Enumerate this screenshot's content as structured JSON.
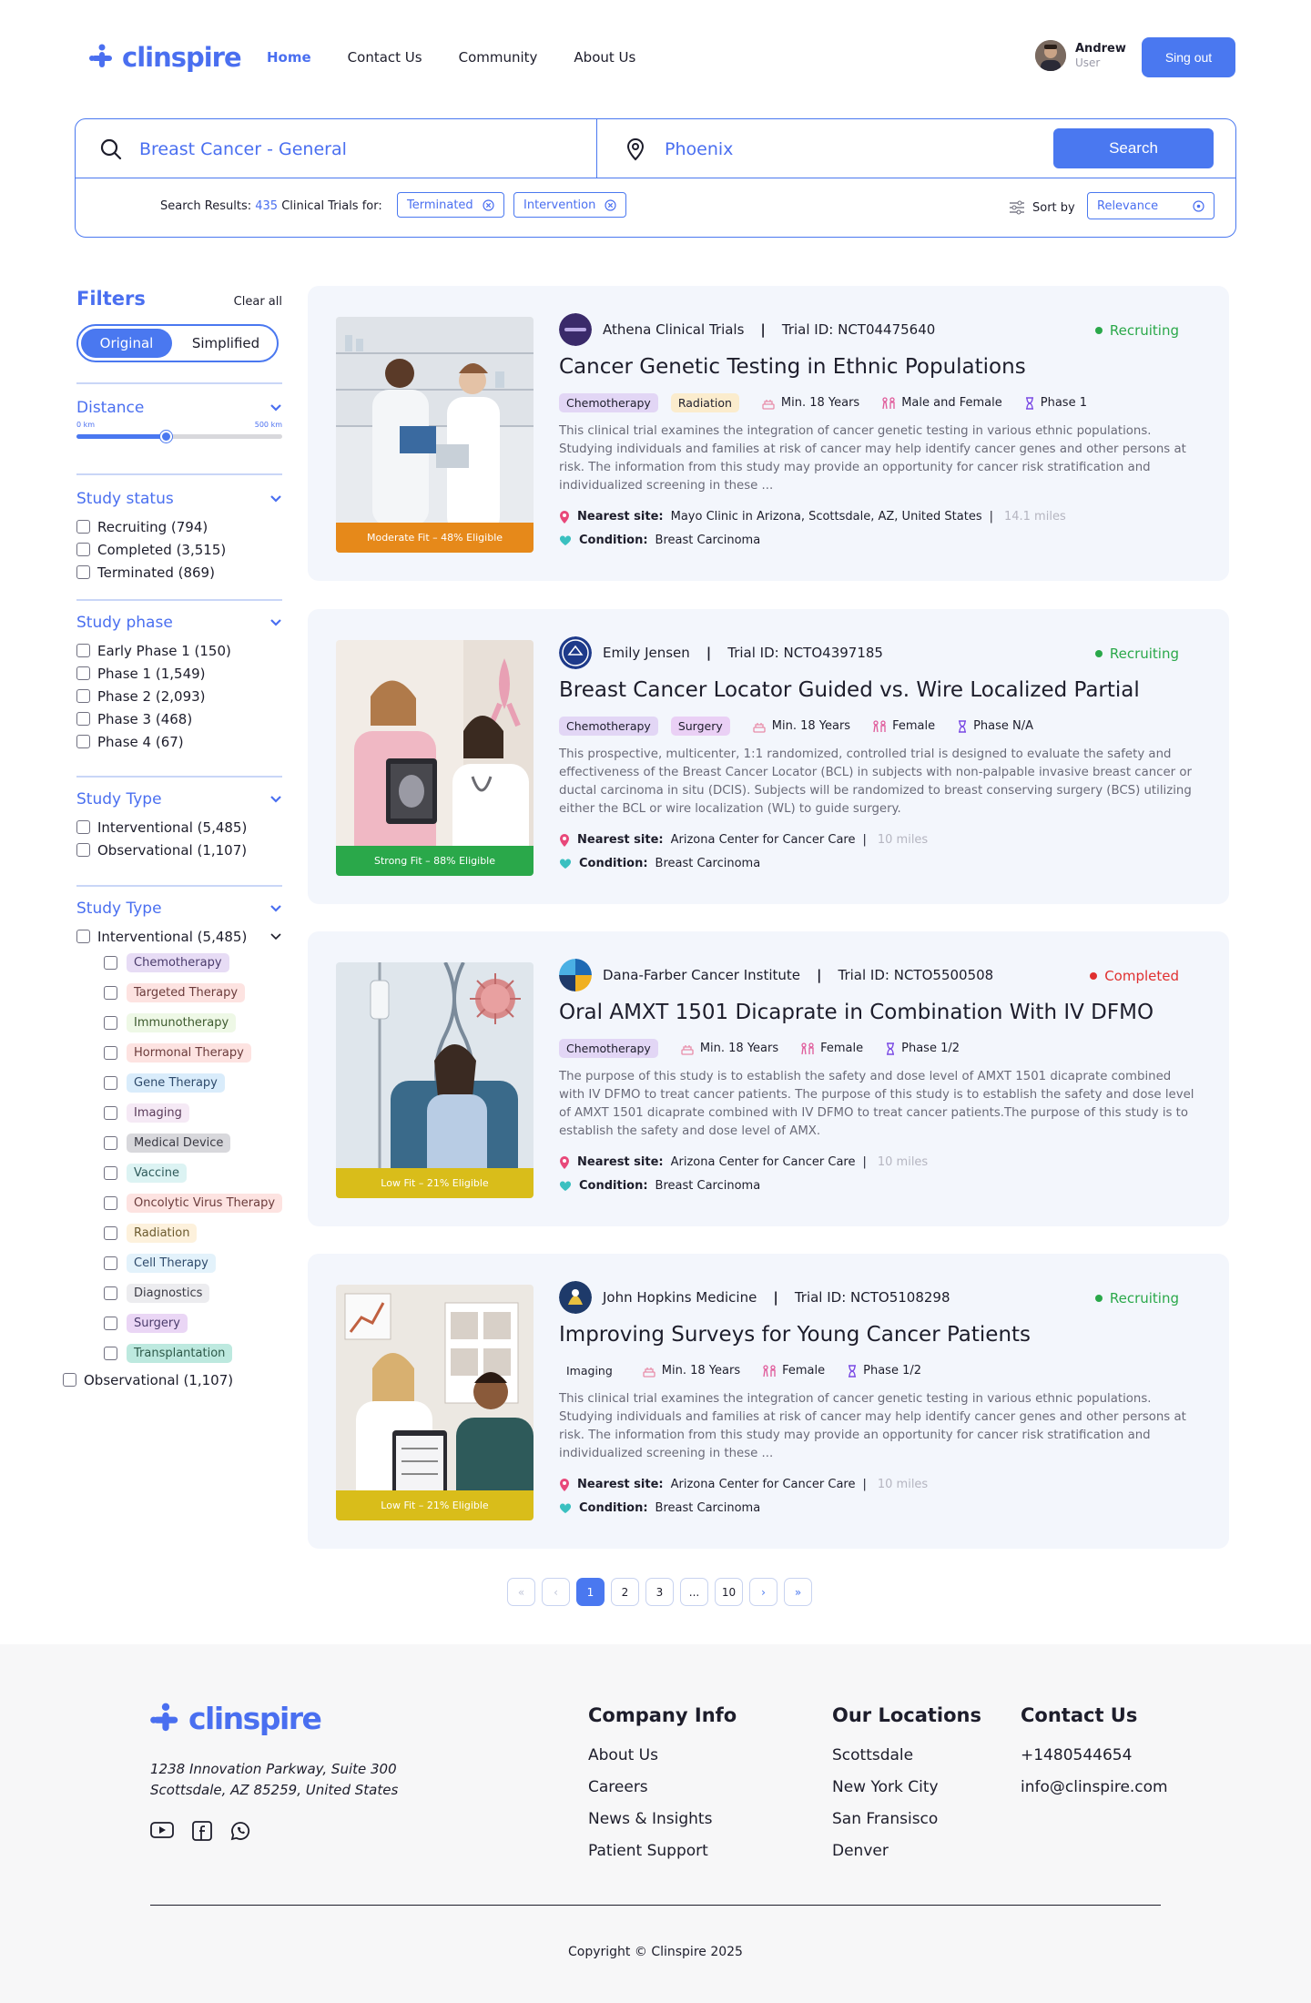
{
  "brand": {
    "name": "clinspire"
  },
  "nav": {
    "home": "Home",
    "contact": "Contact Us",
    "community": "Community",
    "about": "About Us"
  },
  "user": {
    "name": "Andrew",
    "role": "User",
    "signout": "Sing out"
  },
  "search": {
    "query": "Breast Cancer - General",
    "location": "Phoenix",
    "button": "Search",
    "results_prefix": "Search Results:",
    "results_count": "435",
    "results_suffix": "Clinical Trials for:",
    "chips": [
      "Terminated",
      "Intervention"
    ],
    "sort_label": "Sort by",
    "sort_value": "Relevance"
  },
  "filters": {
    "title": "Filters",
    "clear": "Clear all",
    "toggle": [
      "Original",
      "Simplified"
    ],
    "distance": {
      "title": "Distance",
      "min_label": "0 km",
      "max_label": "500 km",
      "value_fraction": 0.44
    },
    "study_status": {
      "title": "Study status",
      "items": [
        "Recruiting (794)",
        "Completed (3,515)",
        "Terminated (869)"
      ]
    },
    "study_phase": {
      "title": "Study phase",
      "items": [
        "Early Phase 1 (150)",
        "Phase 1 (1,549)",
        "Phase 2 (2,093)",
        "Phase 3 (468)",
        "Phase 4 (67)"
      ]
    },
    "study_type": {
      "title": "Study Type",
      "items": [
        "Interventional (5,485)",
        "Observational (1,107)"
      ]
    },
    "study_type2": {
      "title": "Study Type",
      "interventional": "Interventional (5,485)",
      "tags": [
        {
          "label": "Chemotherapy",
          "bg": "#e7dcf5",
          "fg": "#4a3b6b"
        },
        {
          "label": "Targeted Therapy",
          "bg": "#fde3e1",
          "fg": "#6b3b3b"
        },
        {
          "label": "Immunotherapy",
          "bg": "#eef8e6",
          "fg": "#3d5a2e"
        },
        {
          "label": "Hormonal Therapy",
          "bg": "#fde3e1",
          "fg": "#6b3b3b"
        },
        {
          "label": "Gene Therapy",
          "bg": "#d9ecfb",
          "fg": "#2e4a6b"
        },
        {
          "label": "Imaging",
          "bg": "#f5e9f5",
          "fg": "#5a3b5a"
        },
        {
          "label": "Medical Device",
          "bg": "#d8d8dc",
          "fg": "#3b3b45"
        },
        {
          "label": "Vaccine",
          "bg": "#dcf3f3",
          "fg": "#2e5a5a"
        },
        {
          "label": "Oncolytic Virus Therapy",
          "bg": "#fde3e1",
          "fg": "#6b3b3b"
        },
        {
          "label": "Radiation",
          "bg": "#fdf1dc",
          "fg": "#6b5a2e"
        },
        {
          "label": "Cell Therapy",
          "bg": "#e3f2fb",
          "fg": "#2e4a6b"
        },
        {
          "label": "Diagnostics",
          "bg": "#ececef",
          "fg": "#3b3b45"
        },
        {
          "label": "Surgery",
          "bg": "#ead6f5",
          "fg": "#4a3b6b"
        },
        {
          "label": "Transplantation",
          "bg": "#bde9df",
          "fg": "#2e5a4a"
        }
      ],
      "observational": "Observational (1,107)"
    }
  },
  "trials": [
    {
      "org": "Athena Clinical Trials",
      "trial_id": "Trial ID: NCT04475640",
      "status": "Recruiting",
      "status_color": "#2aa84a",
      "title": "Cancer Genetic Testing in Ethnic Populations",
      "tags": [
        {
          "label": "Chemotherapy",
          "bg": "#e2d6f5"
        },
        {
          "label": "Radiation",
          "bg": "#fbeccd"
        }
      ],
      "age": "Min. 18 Years",
      "sex": "Male and Female",
      "phase": "Phase 1",
      "description": "This clinical trial examines the integration of cancer genetic testing in various ethnic populations. Studying individuals and families at risk of cancer may help identify cancer genes and other persons at risk. The information from this study may provide an opportunity for cancer risk stratification and individualized screening in these ...",
      "site_label": "Nearest site:",
      "site": "Mayo Clinic in Arizona, Scottsdale, AZ, United States",
      "miles": "14.1 miles",
      "condition_label": "Condition:",
      "condition": "Breast Carcinoma",
      "fit": "Moderate Fit – 48% Eligible",
      "fit_color": "#e6891a"
    },
    {
      "org": "Emily Jensen",
      "trial_id": "Trial ID: NCTO4397185",
      "status": "Recruiting",
      "status_color": "#2aa84a",
      "title": "Breast Cancer Locator Guided vs. Wire Localized Partial",
      "tags": [
        {
          "label": "Chemotherapy",
          "bg": "#e2d6f5"
        },
        {
          "label": "Surgery",
          "bg": "#ead0f5"
        }
      ],
      "age": "Min. 18 Years",
      "sex": "Female",
      "phase": "Phase N/A",
      "description": "This prospective, multicenter, 1:1 randomized, controlled trial is designed to evaluate the safety and effectiveness of the Breast Cancer Locator (BCL) in subjects with non-palpable invasive breast cancer or ductal carcinoma in situ (DCIS). Subjects will be randomized to breast conserving surgery (BCS) utilizing either the BCL or wire localization (WL) to guide surgery.",
      "site_label": "Nearest site:",
      "site": "Arizona Center for Cancer Care",
      "miles": "10 miles",
      "condition_label": "Condition:",
      "condition": "Breast Carcinoma",
      "fit": "Strong Fit – 88% Eligible",
      "fit_color": "#2aa84a"
    },
    {
      "org": "Dana-Farber Cancer Institute",
      "trial_id": "Trial ID: NCTO5500508",
      "status": "Completed",
      "status_color": "#e03030",
      "title": "Oral AMXT 1501 Dicaprate in Combination With IV DFMO",
      "tags": [
        {
          "label": "Chemotherapy",
          "bg": "#e2d6f5"
        }
      ],
      "age": "Min. 18 Years",
      "sex": "Female",
      "phase": "Phase 1/2",
      "description": "The purpose of this study is to establish the safety and dose level of AMXT 1501 dicaprate combined with IV DFMO to treat cancer patients. The purpose of this study is to establish the safety and dose level of AMXT 1501 dicaprate combined with IV DFMO to treat cancer patients.The purpose of this study is to establish the safety and dose level of AMX.",
      "site_label": "Nearest site:",
      "site": "Arizona Center for Cancer Care",
      "miles": "10 miles",
      "condition_label": "Condition:",
      "condition": "Breast Carcinoma",
      "fit": "Low Fit – 21% Eligible",
      "fit_color": "#d9bd1a"
    },
    {
      "org": "John Hopkins Medicine",
      "trial_id": "Trial ID: NCTO5108298",
      "status": "Recruiting",
      "status_color": "#2aa84a",
      "title": "Improving Surveys for Young Cancer Patients",
      "tags": [
        {
          "label": "Imaging",
          "bg": "transparent"
        }
      ],
      "age": "Min. 18 Years",
      "sex": "Female",
      "phase": "Phase 1/2",
      "description": "This clinical trial examines the integration of cancer genetic testing in various ethnic populations. Studying individuals and families at risk of cancer may help identify cancer genes and other persons at risk. The information from this study may provide an opportunity for cancer risk stratification and individualized screening in these ...",
      "site_label": "Nearest site:",
      "site": "Arizona Center for Cancer Care",
      "miles": "10 miles",
      "condition_label": "Condition:",
      "condition": "Breast Carcinoma",
      "fit": "Low Fit – 21% Eligible",
      "fit_color": "#d9bd1a"
    }
  ],
  "pagination": {
    "first": "«",
    "prev": "‹",
    "pages": [
      "1",
      "2",
      "3",
      "...",
      "10"
    ],
    "next": "›",
    "last": "»",
    "current": "1"
  },
  "footer": {
    "address_line1": "1238 Innovation Parkway, Suite 300",
    "address_line2": "Scottsdale, AZ 85259, United States",
    "company": {
      "title": "Company Info",
      "items": [
        "About Us",
        "Careers",
        "News & Insights",
        "Patient Support"
      ]
    },
    "locations": {
      "title": "Our Locations",
      "items": [
        "Scottsdale",
        "New York City",
        "San Fransisco",
        "Denver"
      ]
    },
    "contact": {
      "title": "Contact Us",
      "items": [
        "+1480544654",
        "info@clinspire.com"
      ]
    },
    "copyright": "Copyright © Clinspire 2025"
  }
}
